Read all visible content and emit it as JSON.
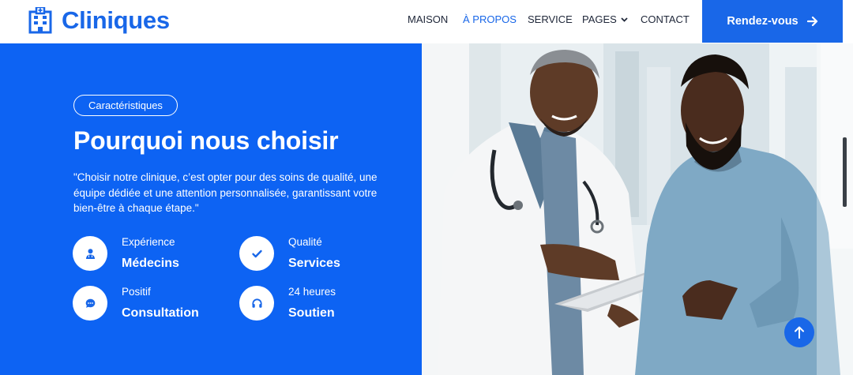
{
  "header": {
    "brand_name": "Cliniques",
    "brand_icon": "hospital-building-icon",
    "nav": [
      {
        "label": "MAISON",
        "active": false
      },
      {
        "label": "À PROPOS",
        "active": true
      },
      {
        "label": "SERVICE",
        "active": false
      },
      {
        "label": "PAGES",
        "active": false,
        "dropdown": true
      },
      {
        "label": "CONTACT",
        "active": false
      }
    ],
    "cta_label": "Rendez-vous",
    "cta_icon": "arrow-right-icon"
  },
  "features_section": {
    "badge": "Caractéristiques",
    "title": "Pourquoi nous choisir",
    "quote": "\"Choisir notre clinique, c’est opter pour des soins de qualité, une équipe dédiée et une attention personnalisée, garantissant votre bien-être à chaque étape.\"",
    "items": [
      {
        "small": "Expérience",
        "big": "Médecins",
        "icon": "doctor-icon"
      },
      {
        "small": "Qualité",
        "big": "Services",
        "icon": "check-icon"
      },
      {
        "small": "Positif",
        "big": "Consultation",
        "icon": "chat-icon"
      },
      {
        "small": "24 heures",
        "big": "Soutien",
        "icon": "headset-icon"
      }
    ]
  },
  "photo": {
    "subject": "doctor-and-patient-photo"
  },
  "scroll_top_icon": "arrow-up-icon",
  "colors": {
    "primary": "#1967e8",
    "panel_blue": "#0d63f3",
    "nav_text": "#20283a",
    "white": "#ffffff"
  }
}
